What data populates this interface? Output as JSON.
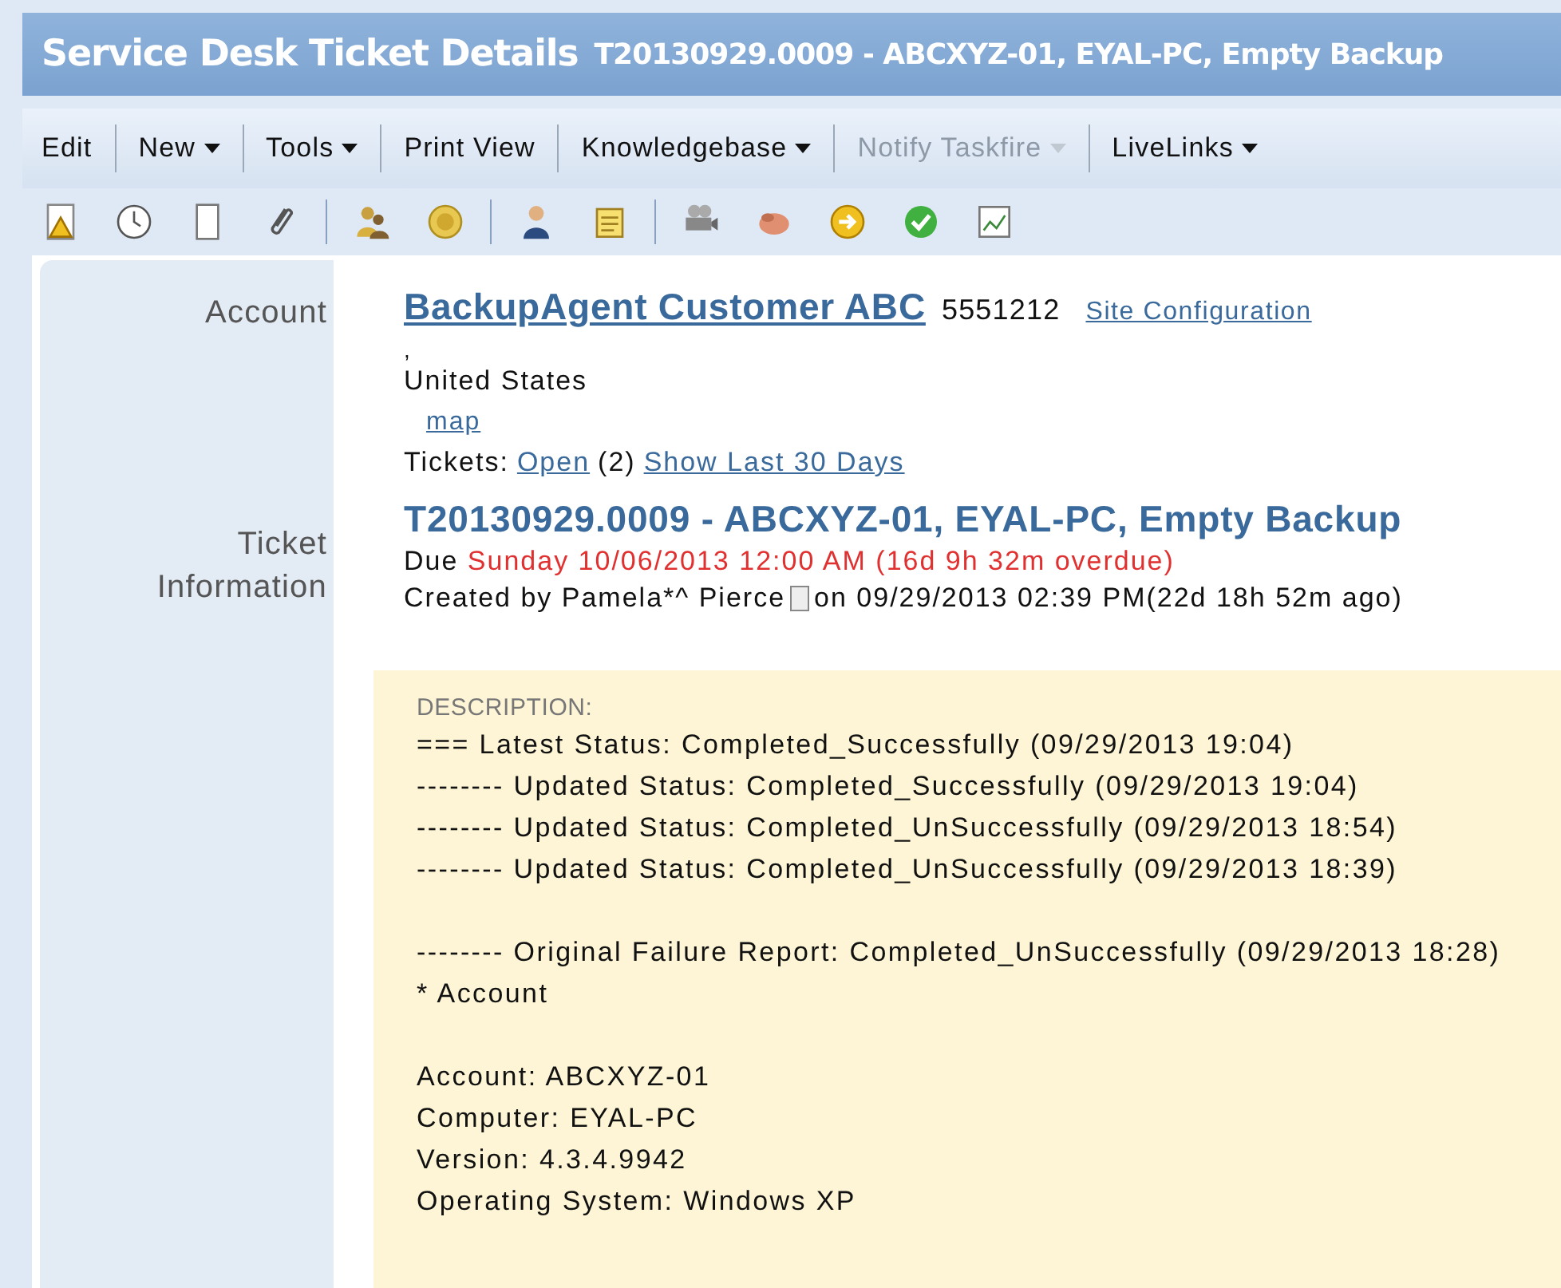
{
  "window": {
    "title": "Service Desk Ticket Details",
    "subtitle": "T20130929.0009 - ABCXYZ-01, EYAL-PC, Empty Backup"
  },
  "menu": [
    {
      "label": "Edit",
      "dropdown": false,
      "disabled": false
    },
    {
      "label": "New",
      "dropdown": true,
      "disabled": false
    },
    {
      "label": "Tools",
      "dropdown": true,
      "disabled": false
    },
    {
      "label": "Print View",
      "dropdown": false,
      "disabled": false
    },
    {
      "label": "Knowledgebase",
      "dropdown": true,
      "disabled": false
    },
    {
      "label": "Notify Taskfire",
      "dropdown": true,
      "disabled": true
    },
    {
      "label": "LiveLinks",
      "dropdown": true,
      "disabled": false
    }
  ],
  "account": {
    "label": "Account",
    "name": "BackupAgent Customer ABC",
    "phone": "5551212",
    "site_link": "Site Configuration",
    "address_line": ",",
    "country": "United States",
    "map_link": "map",
    "tickets_label": "Tickets:",
    "open_link": "Open",
    "open_count": "(2)",
    "last_link": "Show Last 30 Days"
  },
  "ticket": {
    "label_1": "Ticket",
    "label_2": "Information",
    "title": "T20130929.0009 - ABCXYZ-01, EYAL-PC, Empty Backup",
    "due_label": "Due",
    "due": "Sunday 10/06/2013 12:00 AM (16d 9h 32m overdue)",
    "overdue": true,
    "created_by": "Created by Pamela*^ Pierce",
    "created_on": "on 09/29/2013 02:39 PM(22d 18h 52m ago)"
  },
  "description": {
    "heading": "DESCRIPTION:",
    "paragraphs": [
      [
        "=== Latest Status: Completed_Successfully (09/29/2013 19:04)",
        "-------- Updated Status: Completed_Successfully (09/29/2013 19:04)",
        "-------- Updated Status: Completed_UnSuccessfully (09/29/2013 18:54)",
        "-------- Updated Status: Completed_UnSuccessfully (09/29/2013 18:39)"
      ],
      [
        "-------- Original Failure Report: Completed_UnSuccessfully (09/29/2013 18:28)",
        "* Account"
      ],
      [
        "Account: ABCXYZ-01",
        "Computer: EYAL-PC",
        "Version: 4.3.4.9942",
        "Operating System: Windows XP"
      ]
    ]
  }
}
